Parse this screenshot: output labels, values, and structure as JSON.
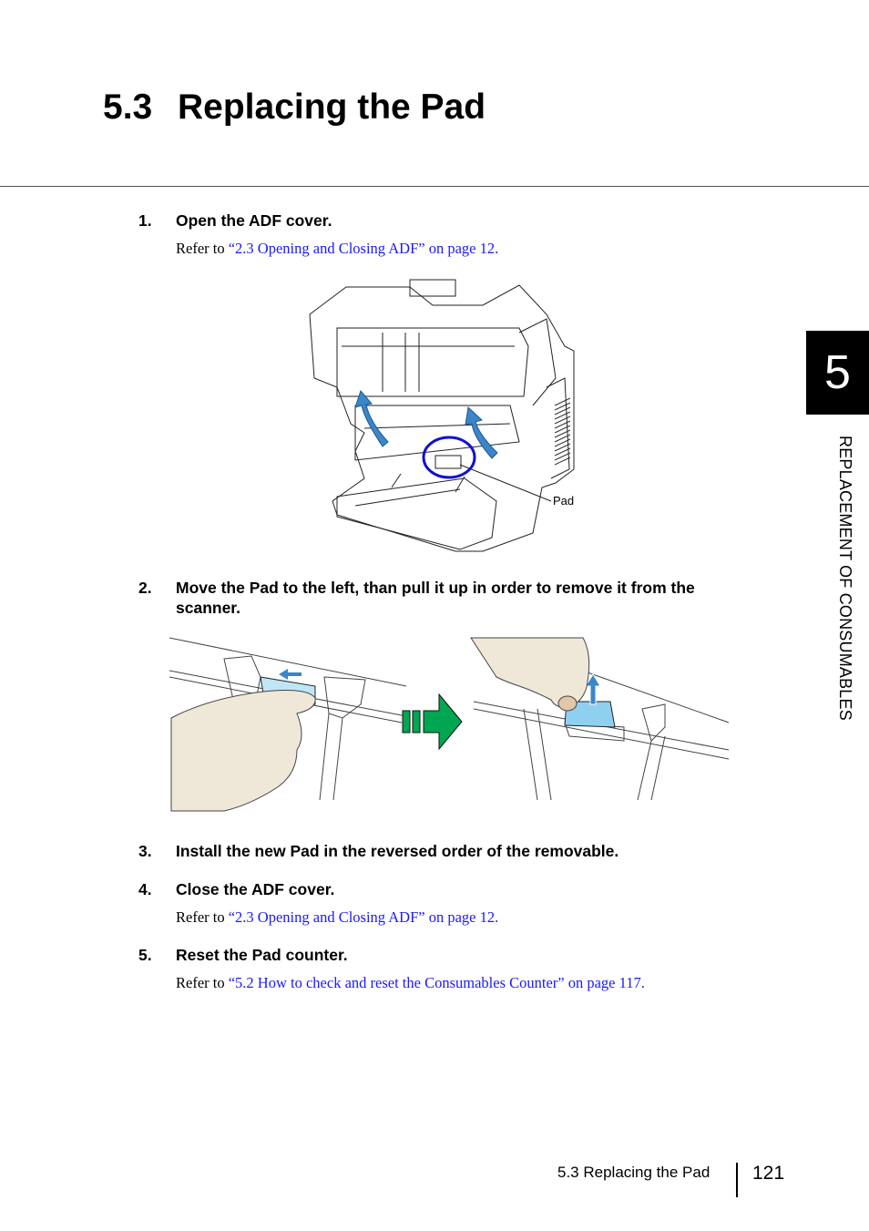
{
  "heading": {
    "number": "5.3",
    "title": "Replacing the Pad"
  },
  "chapter_tab": {
    "number": "5",
    "label": "REPLACEMENT OF CONSUMABLES"
  },
  "steps": [
    {
      "number": "1.",
      "text": "Open the ADF cover.",
      "ref_prefix": "Refer to ",
      "ref_link": "“2.3 Opening and Closing ADF” on page 12."
    },
    {
      "number": "2.",
      "text": "Move the Pad to the left, than pull it up in order to remove it from the scanner."
    },
    {
      "number": "3.",
      "text": "Install the new Pad in the reversed order of the removable."
    },
    {
      "number": "4.",
      "text": "Close the ADF cover.",
      "ref_prefix": "Refer to ",
      "ref_link": "“2.3 Opening and Closing ADF” on page 12."
    },
    {
      "number": "5.",
      "text": "Reset the Pad counter.",
      "ref_prefix": "Refer to ",
      "ref_link": "“5.2 How to check and reset the Consumables Counter” on page 117."
    }
  ],
  "figure1": {
    "callout_label": "Pad",
    "description": "Scanner with ADF open; arrows indicate lifting cover; circle highlights the Pad"
  },
  "figure2": {
    "description": "Hand slides Pad left, then pulls it up; green arrow indicates sequence"
  },
  "colors": {
    "link": "#1a1aff",
    "arrow_blue": "#3a86c8",
    "pad_blue": "#8fd0f0",
    "circle_blue": "#1010d0",
    "next_arrow_green": "#00a651",
    "hand": "#efe8d8"
  },
  "footer": {
    "section": "5.3 Replacing the Pad",
    "page": "121"
  }
}
